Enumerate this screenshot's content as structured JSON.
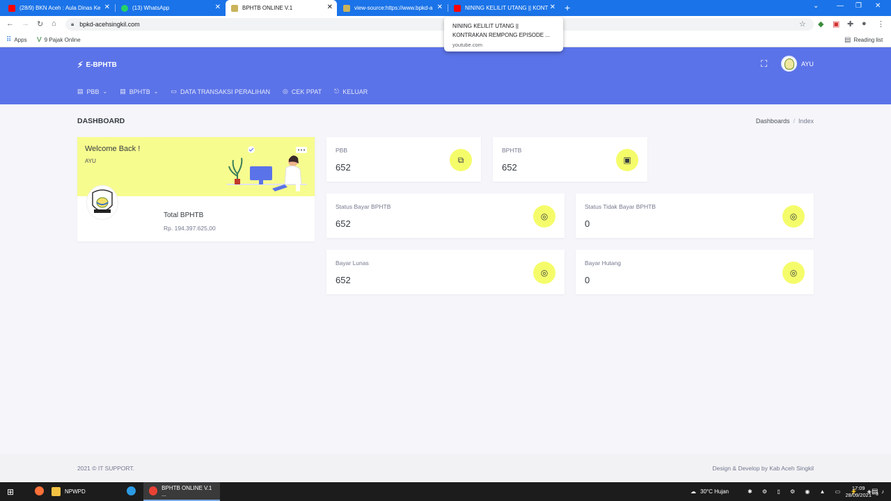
{
  "browser": {
    "tabs": [
      {
        "title": "(28/9) BKN Aceh : Aula Dinas Ke",
        "favicon_color": "#ff0000"
      },
      {
        "title": "(13) WhatsApp",
        "favicon_color": "#25d366"
      },
      {
        "title": "BPHTB ONLINE V.1",
        "favicon_color": "#c9b35a"
      },
      {
        "title": "view-source:https://www.bpkd-a",
        "favicon_color": "#c9b35a"
      },
      {
        "title": "NINING KELILIT UTANG || KONTR",
        "favicon_color": "#ff0000"
      }
    ],
    "url": "bpkd-acehsingkil.com",
    "bookmarks": [
      "Apps",
      "9 Pajak Online"
    ],
    "reading_list": "Reading list",
    "tooltip": {
      "line1": "NINING KELILIT UTANG ||",
      "line2": "KONTRAKAN REMPONG EPISODE ...",
      "source": "youtube.com"
    }
  },
  "header": {
    "brand": "E-BPHTB",
    "user": "AYU",
    "menu": [
      {
        "label": "PBB",
        "icon": "table-icon",
        "has_dropdown": true
      },
      {
        "label": "BPHTB",
        "icon": "table-icon",
        "has_dropdown": true
      },
      {
        "label": "DATA TRANSAKSI PERALIHAN",
        "icon": "calendar-icon",
        "has_dropdown": false
      },
      {
        "label": "CEK PPAT",
        "icon": "user-circle-icon",
        "has_dropdown": false
      },
      {
        "label": "KELUAR",
        "icon": "logout-icon",
        "has_dropdown": false
      }
    ]
  },
  "page": {
    "title": "DASHBOARD",
    "breadcrumb": [
      "Dashboards",
      "Index"
    ]
  },
  "welcome": {
    "heading": "Welcome Back !",
    "user": "AYU",
    "total_label": "Total BPHTB",
    "total_value": "Rp. 194.397.625,00"
  },
  "stats": {
    "pbb": {
      "label": "PBB",
      "value": "652",
      "icon": "copy-icon"
    },
    "bphtb": {
      "label": "BPHTB",
      "value": "652",
      "icon": "archive-icon"
    },
    "status_bayar": {
      "label": "Status Bayar BPHTB",
      "value": "652",
      "icon": "user-circle-icon"
    },
    "status_tidak_bayar": {
      "label": "Status Tidak Bayar BPHTB",
      "value": "0",
      "icon": "user-circle-icon"
    },
    "bayar_lunas": {
      "label": "Bayar Lunas",
      "value": "652",
      "icon": "user-circle-icon"
    },
    "bayar_hutang": {
      "label": "Bayar Hutang",
      "value": "0",
      "icon": "user-circle-icon"
    }
  },
  "footer": {
    "left": "2021 © IT SUPPORT.",
    "right": "Design & Develop by Kab Aceh Singkil"
  },
  "taskbar": {
    "apps": [
      "NPWPD",
      "BPHTB ONLINE V.1 ..."
    ],
    "weather": "30°C  Hujan",
    "time": "17:09",
    "date": "28/09/2021",
    "notification_count": "3"
  },
  "colors": {
    "header_bg": "#5b73e8",
    "welcome_bg": "#f7fc8f",
    "icon_badge": "#f5fc6a"
  }
}
